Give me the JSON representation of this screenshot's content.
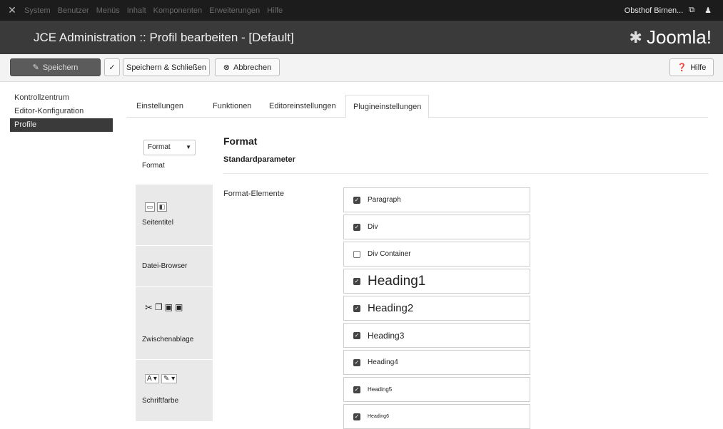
{
  "topnav": {
    "menus": [
      "System",
      "Benutzer",
      "Menüs",
      "Inhalt",
      "Komponenten",
      "Erweiterungen",
      "Hilfe"
    ],
    "site_label": "Obsthof Birnen...",
    "external_icon": "external-link-icon",
    "user_icon": "user-icon"
  },
  "header": {
    "title": "JCE Administration :: Profil bearbeiten - [Default]",
    "brand": "Joomla!"
  },
  "toolbar": {
    "save": "Speichern",
    "save_close": "Speichern & Schließen",
    "cancel": "Abbrechen",
    "help": "Hilfe"
  },
  "sidebar": {
    "items": [
      {
        "label": "Kontrollzentrum"
      },
      {
        "label": "Editor-Konfiguration"
      },
      {
        "label": "Profile"
      }
    ]
  },
  "tabs": [
    {
      "label": "Einstellungen"
    },
    {
      "label": "Funktionen"
    },
    {
      "label": "Editoreinstellungen"
    },
    {
      "label": "Plugineinstellungen"
    }
  ],
  "plugins": {
    "format_select": "Format",
    "items": [
      {
        "label": "Format"
      },
      {
        "label": "Seitentitel"
      },
      {
        "label": "Datei-Browser"
      },
      {
        "label": "Zwischenablage"
      },
      {
        "label": "Schriftfarbe"
      }
    ]
  },
  "panel": {
    "title": "Format",
    "subtitle": "Standardparameter",
    "field_label": "Format-Elemente"
  },
  "formats": [
    {
      "label": "Paragraph",
      "checked": true
    },
    {
      "label": "Div",
      "checked": true
    },
    {
      "label": "Div Container",
      "checked": false
    },
    {
      "label": "Heading1",
      "checked": true
    },
    {
      "label": "Heading2",
      "checked": true
    },
    {
      "label": "Heading3",
      "checked": true
    },
    {
      "label": "Heading4",
      "checked": true
    },
    {
      "label": "Heading5",
      "checked": true
    },
    {
      "label": "Heading6",
      "checked": true
    }
  ]
}
